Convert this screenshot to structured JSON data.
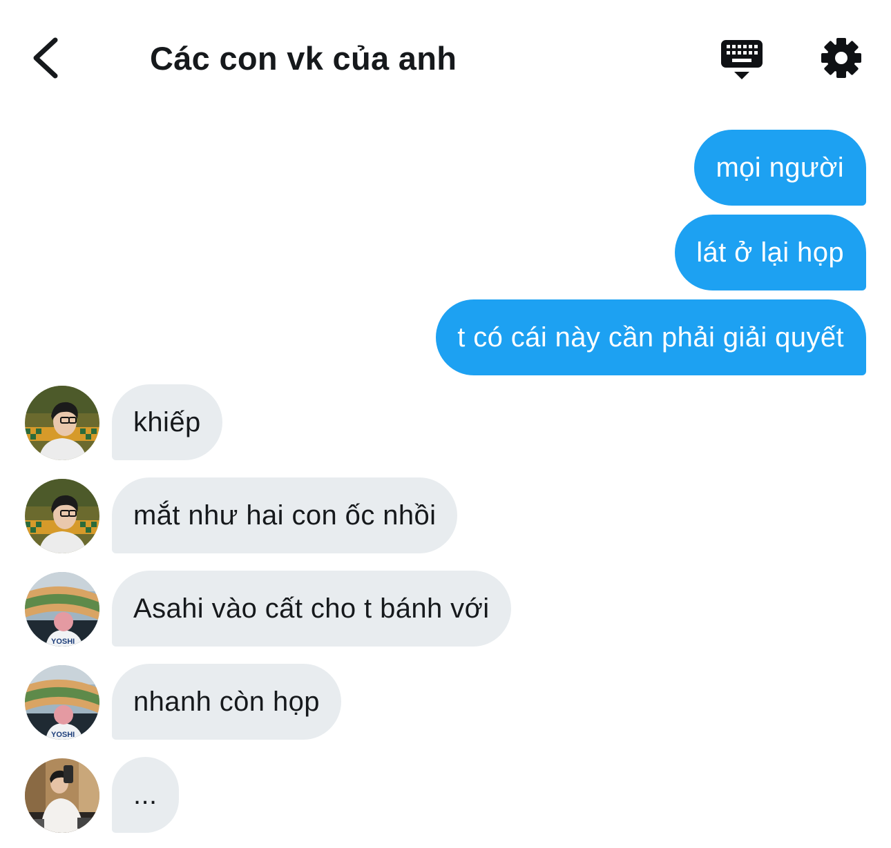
{
  "header": {
    "title": "Các con vk của anh",
    "back_icon": "chevron-left-icon",
    "keyboard_icon": "keyboard-icon",
    "settings_icon": "gear-icon"
  },
  "messages": [
    {
      "direction": "outgoing",
      "text": "mọi người"
    },
    {
      "direction": "outgoing",
      "text": "lát ở lại họp"
    },
    {
      "direction": "outgoing",
      "text": "t có cái này cần phải giải quyết"
    },
    {
      "direction": "incoming",
      "sender_avatar": "avatar-glasses-boy",
      "text": "khiếp"
    },
    {
      "direction": "incoming",
      "sender_avatar": "avatar-glasses-boy",
      "text": "mắt như hai con ốc nhồi"
    },
    {
      "direction": "incoming",
      "sender_avatar": "avatar-stadium-pink-hair",
      "text": "Asahi vào cất cho t bánh với"
    },
    {
      "direction": "incoming",
      "sender_avatar": "avatar-stadium-pink-hair",
      "text": "nhanh còn họp"
    },
    {
      "direction": "incoming",
      "sender_avatar": "avatar-mirror-selfie",
      "text": "..."
    }
  ],
  "avatar_labels": {
    "stadium_shirt": "YOSHI"
  },
  "colors": {
    "outgoing_bubble": "#1da1f2",
    "incoming_bubble": "#e8ecef",
    "text": "#16191c",
    "background": "#ffffff"
  }
}
